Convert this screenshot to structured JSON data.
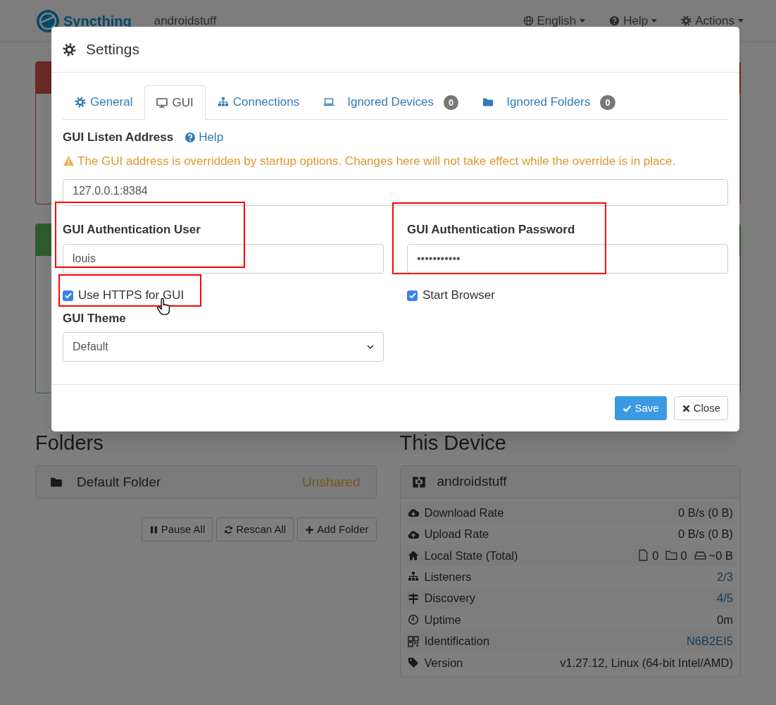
{
  "navbar": {
    "brand": "Syncthing",
    "device": "androidstuff",
    "menus": [
      {
        "label": "English"
      },
      {
        "label": "Help"
      },
      {
        "label": "Actions"
      }
    ]
  },
  "alerts": [
    {
      "kind": "danger"
    },
    {
      "kind": "success"
    }
  ],
  "folders": {
    "title": "Folders",
    "items": [
      {
        "name": "Default Folder",
        "status": "Unshared"
      }
    ],
    "buttons": [
      {
        "label": "Pause All"
      },
      {
        "label": "Rescan All"
      },
      {
        "label": "Add Folder"
      }
    ]
  },
  "this_device": {
    "title": "This Device",
    "name": "androidstuff",
    "rows": [
      {
        "label": "Download Rate",
        "kind": "text",
        "value": "0 B/s (0 B)"
      },
      {
        "label": "Upload Rate",
        "kind": "text",
        "value": "0 B/s (0 B)"
      },
      {
        "label": "Local State (Total)",
        "kind": "counts",
        "parts": [
          "0",
          "0",
          "~0 B"
        ]
      },
      {
        "label": "Listeners",
        "kind": "link",
        "value": "2/3"
      },
      {
        "label": "Discovery",
        "kind": "link",
        "value": "4/5"
      },
      {
        "label": "Uptime",
        "kind": "text",
        "value": "0m"
      },
      {
        "label": "Identification",
        "kind": "link",
        "value": "N6B2EI5"
      },
      {
        "label": "Version",
        "kind": "text",
        "value": "v1.27.12, Linux (64-bit Intel/AMD)"
      }
    ]
  },
  "modal": {
    "title": "Settings",
    "tabs": [
      {
        "label": "General",
        "selected": false
      },
      {
        "label": "GUI",
        "selected": true
      },
      {
        "label": "Connections",
        "selected": false
      },
      {
        "label": "Ignored Devices",
        "badge": "0",
        "selected": false
      },
      {
        "label": "Ignored Folders",
        "badge": "0",
        "selected": false
      }
    ],
    "listen_address": {
      "label": "GUI Listen Address",
      "help": "Help",
      "warning": "The GUI address is overridden by startup options. Changes here will not take effect while the override is in place.",
      "value": "127.0.0.1:8384"
    },
    "user": {
      "label": "GUI Authentication User",
      "value": "louis"
    },
    "password": {
      "label": "GUI Authentication Password",
      "value": "•••••••••••"
    },
    "checkboxes": [
      {
        "label": "Use HTTPS for GUI",
        "checked": true
      },
      {
        "label": "Start Browser",
        "checked": true
      }
    ],
    "theme": {
      "label": "GUI Theme",
      "value": "Default"
    },
    "buttons": [
      {
        "kind": "primary",
        "label": "Save"
      },
      {
        "kind": "default",
        "label": "Close"
      }
    ]
  }
}
